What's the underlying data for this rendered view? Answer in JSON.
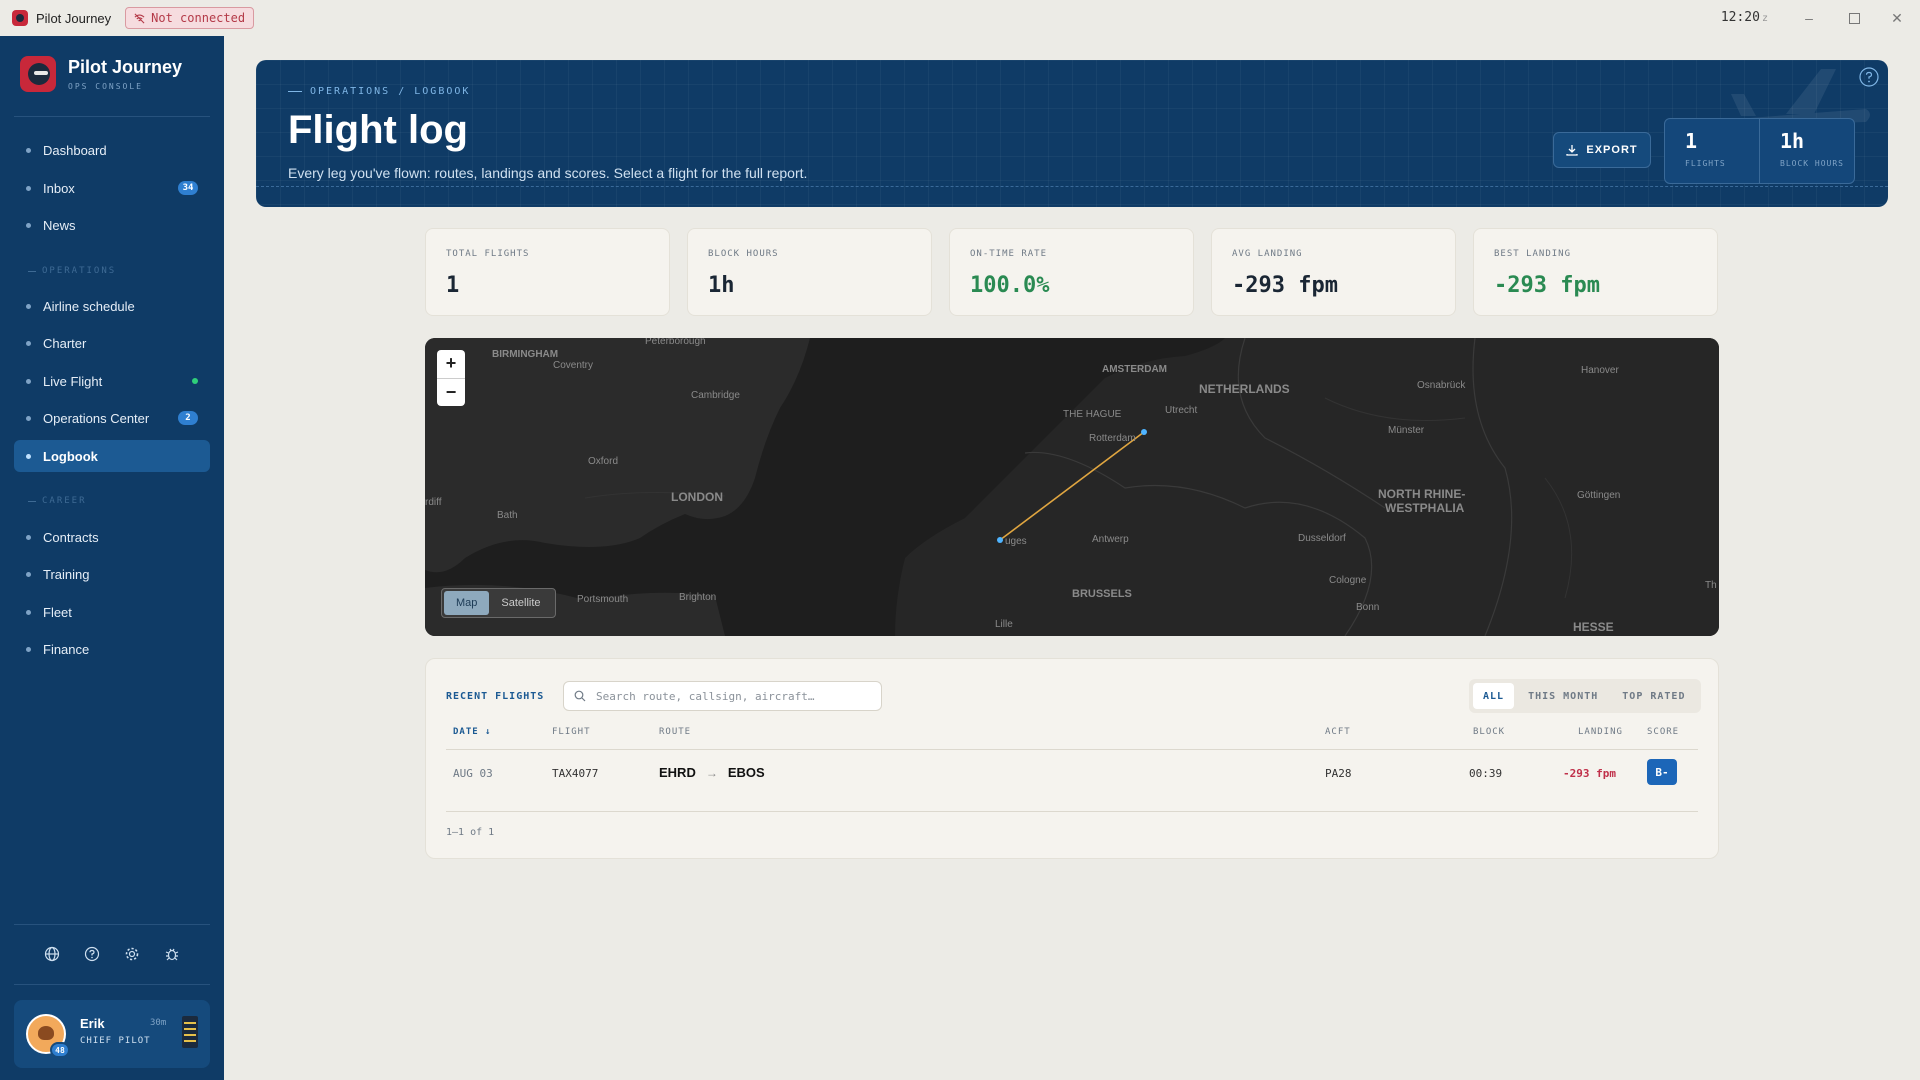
{
  "app": {
    "title": "Pilot Journey",
    "connection_status": "Not connected",
    "clock": "12:20",
    "clock_zone": "z"
  },
  "sidebar": {
    "brand_name": "Pilot Journey",
    "brand_sub": "OPS CONSOLE",
    "items": [
      {
        "label": "Dashboard"
      },
      {
        "label": "Inbox",
        "badge": "34"
      },
      {
        "label": "News"
      }
    ],
    "section_operations": "OPERATIONS",
    "operations_items": [
      {
        "label": "Airline schedule"
      },
      {
        "label": "Charter"
      },
      {
        "label": "Live Flight"
      },
      {
        "label": "Operations Center",
        "badge": "2"
      },
      {
        "label": "Logbook",
        "active": true
      }
    ],
    "section_career": "CAREER",
    "career_items": [
      {
        "label": "Contracts"
      },
      {
        "label": "Training"
      },
      {
        "label": "Fleet"
      },
      {
        "label": "Finance"
      }
    ],
    "tools": [
      "globe-icon",
      "help-icon",
      "settings-icon",
      "bug-icon"
    ],
    "user": {
      "name": "Erik",
      "role": "CHIEF PILOT",
      "time": "30m",
      "level": "48"
    }
  },
  "hero": {
    "breadcrumb": "OPERATIONS / LOGBOOK",
    "title": "Flight log",
    "description": "Every leg you've flown: routes, landings and scores. Select a flight for the full report.",
    "export_label": "EXPORT",
    "stats": [
      {
        "value": "1",
        "label": "FLIGHTS"
      },
      {
        "value": "1h",
        "label": "BLOCK HOURS"
      }
    ]
  },
  "stats": [
    {
      "label": "TOTAL FLIGHTS",
      "value": "1"
    },
    {
      "label": "BLOCK HOURS",
      "value": "1h"
    },
    {
      "label": "ON-TIME RATE",
      "value": "100.0%"
    },
    {
      "label": "AVG LANDING",
      "value": "-293 fpm"
    },
    {
      "label": "BEST LANDING",
      "value": "-293 fpm"
    }
  ],
  "map": {
    "zoom_in": "+",
    "zoom_out": "−",
    "modes": [
      "Map",
      "Satellite"
    ],
    "active_mode": "Map",
    "labels": {
      "birmingham": "BIRMINGHAM",
      "coventry": "Coventry",
      "peterborough": "Peterborough",
      "cambridge": "Cambridge",
      "oxford": "Oxford",
      "london": "LONDON",
      "bath": "Bath",
      "cardiff": "rdiff",
      "portsmouth": "Portsmouth",
      "brighton": "Brighton",
      "amsterdam": "AMSTERDAM",
      "thehague": "THE HAGUE",
      "utrecht": "Utrecht",
      "rotterdam": "Rotterdam",
      "netherlands": "NETHERLANDS",
      "osnabruck": "Osnabrück",
      "hanover": "Hanover",
      "munster": "Münster",
      "nrw1": "NORTH RHINE-",
      "nrw2": "WESTPHALIA",
      "gottingen": "Göttingen",
      "bruges": "uges",
      "antwerp": "Antwerp",
      "dusseldorf": "Dusseldorf",
      "cologne": "Cologne",
      "brussels": "BRUSSELS",
      "bonn": "Bonn",
      "lille": "Lille",
      "hesse": "HESSE",
      "th": "Th"
    }
  },
  "flights": {
    "title": "RECENT FLIGHTS",
    "search_placeholder": "Search route, callsign, aircraft…",
    "filters": [
      "ALL",
      "THIS MONTH",
      "TOP RATED"
    ],
    "active_filter": "ALL",
    "columns": {
      "date": "DATE",
      "flight": "FLIGHT",
      "route": "ROUTE",
      "aircraft": "ACFT",
      "block": "BLOCK",
      "landing": "LANDING",
      "score": "SCORE"
    },
    "rows": [
      {
        "date": "AUG 03",
        "flight": "TAX4077",
        "origin": "EHRD",
        "destination": "EBOS",
        "arrow": "→",
        "aircraft": "PA28",
        "block": "00:39",
        "landing": "-293 fpm",
        "score": "B-"
      }
    ],
    "pagination": "1–1 of 1"
  },
  "colors": {
    "sidebar": "#0f3b66",
    "accent": "#1c5a93",
    "positive": "#2a8a52",
    "negative": "#c0304a",
    "route_line": "#e0a640"
  }
}
